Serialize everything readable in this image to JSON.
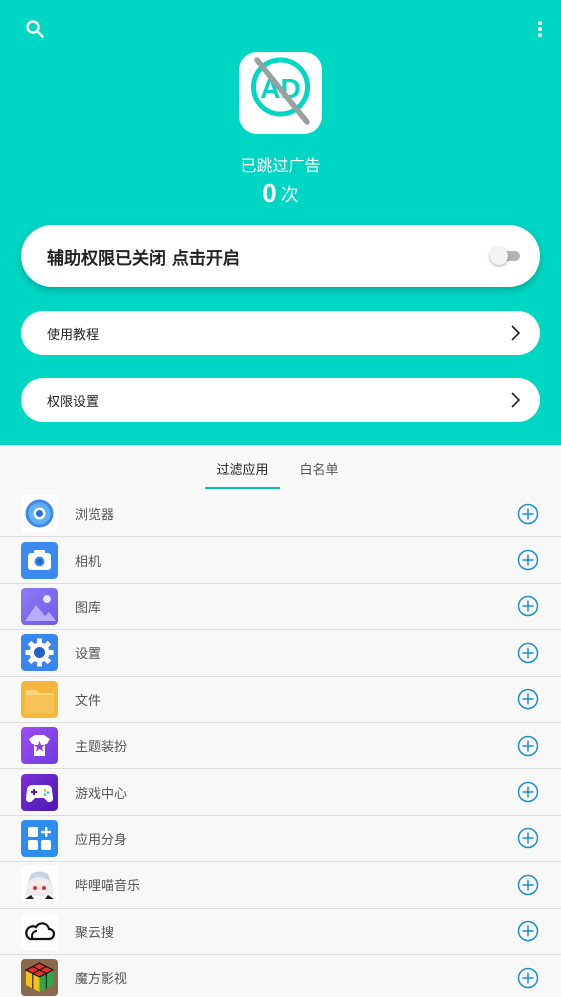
{
  "header": {
    "search_icon": "search-icon",
    "more_icon": "more-vertical-icon",
    "logo_text": "AD",
    "skipped_label": "已跳过广告",
    "skipped_count": "0",
    "skipped_unit": "次"
  },
  "accessibility": {
    "label": "辅助权限已关闭 点击开启",
    "enabled": false
  },
  "menu": {
    "tutorial_label": "使用教程",
    "permissions_label": "权限设置"
  },
  "tabs": [
    {
      "label": "过滤应用",
      "active": true
    },
    {
      "label": "白名单",
      "active": false
    }
  ],
  "apps": [
    {
      "name": "浏览器",
      "icon": "browser-icon"
    },
    {
      "name": "相机",
      "icon": "camera-icon"
    },
    {
      "name": "图库",
      "icon": "gallery-icon"
    },
    {
      "name": "设置",
      "icon": "settings-icon"
    },
    {
      "name": "文件",
      "icon": "folder-icon"
    },
    {
      "name": "主题装扮",
      "icon": "theme-icon"
    },
    {
      "name": "游戏中心",
      "icon": "gamepad-icon"
    },
    {
      "name": "应用分身",
      "icon": "app-clone-icon"
    },
    {
      "name": "哔哩喵音乐",
      "icon": "anime-avatar-icon"
    },
    {
      "name": "聚云搜",
      "icon": "cloud-icon"
    },
    {
      "name": "魔方影视",
      "icon": "rubik-cube-icon"
    }
  ],
  "colors": {
    "accent": "#00d6c4",
    "add_button": "#1a8fd0"
  }
}
